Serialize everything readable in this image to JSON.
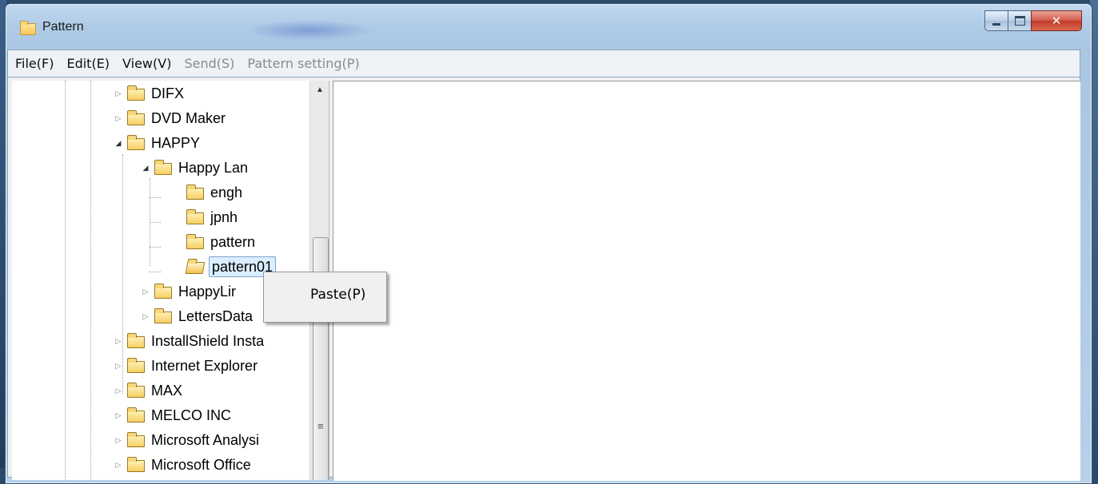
{
  "window": {
    "title": "Pattern",
    "title_icon": "folder-icon"
  },
  "menubar": {
    "file": "File(F)",
    "edit": "Edit(E)",
    "view": "View(V)",
    "send": "Send(S)",
    "pattern_setting": "Pattern setting(P)"
  },
  "tree": {
    "nodes": [
      {
        "label": "DIFX",
        "expanded": false
      },
      {
        "label": "DVD Maker",
        "expanded": false
      },
      {
        "label": "HAPPY",
        "expanded": true
      },
      {
        "label": "Happy Lan",
        "expanded": true
      },
      {
        "label": "engh"
      },
      {
        "label": "jpnh"
      },
      {
        "label": "pattern"
      },
      {
        "label": "pattern01",
        "selected": true
      },
      {
        "label": "HappyLir",
        "expanded": false
      },
      {
        "label": "LettersData",
        "expanded": false
      },
      {
        "label": "InstallShield Insta",
        "expanded": false
      },
      {
        "label": "Internet Explorer",
        "expanded": false
      },
      {
        "label": "MAX",
        "expanded": false
      },
      {
        "label": "MELCO INC",
        "expanded": false
      },
      {
        "label": "Microsoft Analysi",
        "expanded": false
      },
      {
        "label": "Microsoft Office",
        "expanded": false
      }
    ]
  },
  "context_menu": {
    "paste": "Paste(P)"
  },
  "colors": {
    "selection_bg": "#dbeeff",
    "selection_border": "#7da2ce",
    "close_button": "#c23a29"
  }
}
